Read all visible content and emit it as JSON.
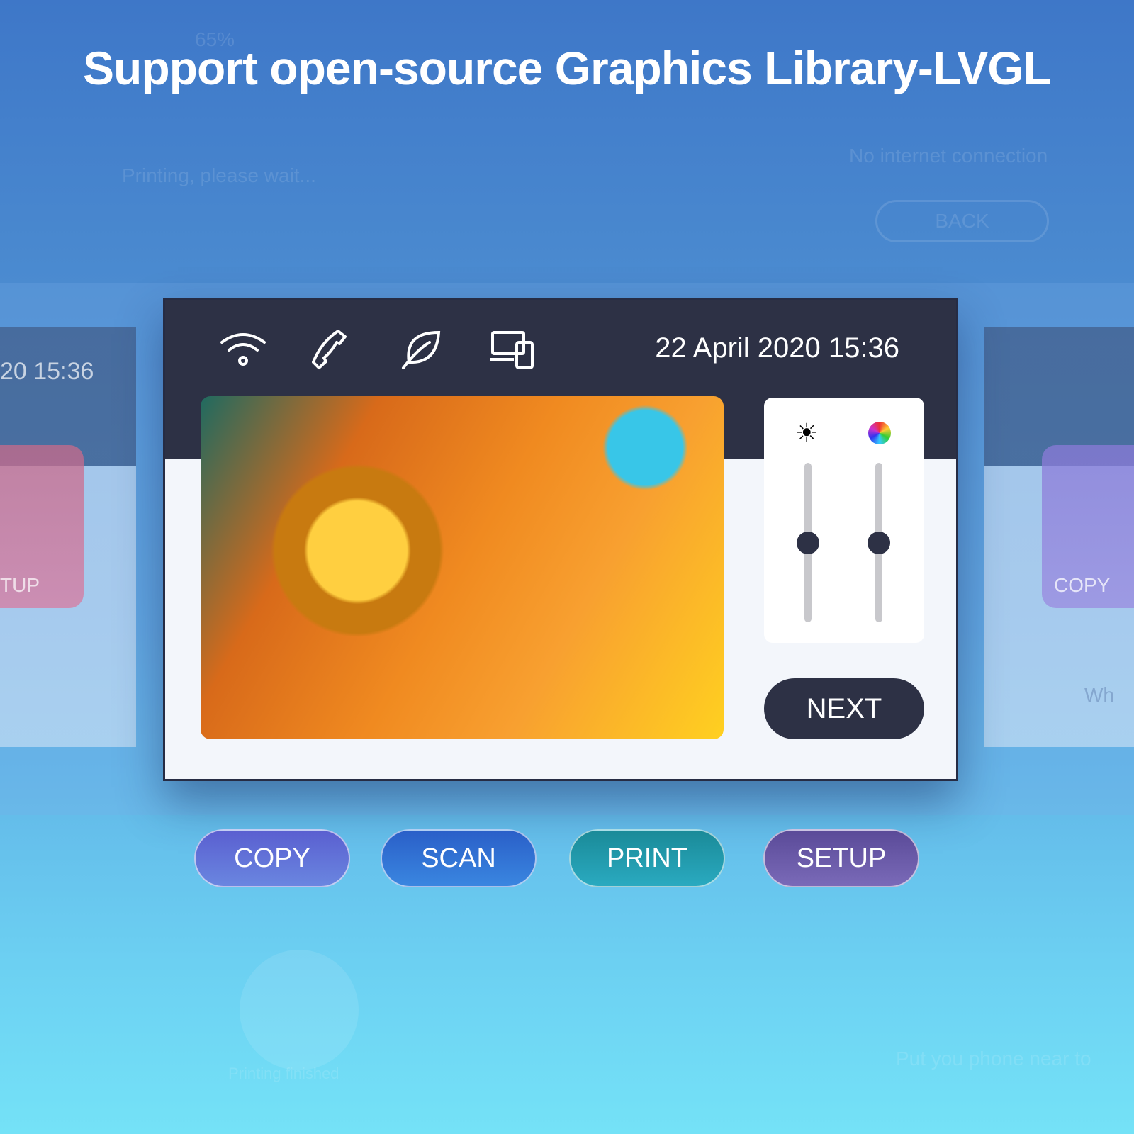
{
  "title": "Support open-source Graphics Library-LVGL",
  "background": {
    "printing_wait": "Printing, please wait...",
    "percent": "65%",
    "no_internet": "No internet connection",
    "back": "BACK",
    "printing_finished": "Printing finished",
    "phone_hint": "Put you phone near to",
    "left_time": "20 15:36",
    "left_label": "TUP",
    "right_label": "COPY",
    "right_text": "Wh"
  },
  "header": {
    "icons": [
      "wifi-icon",
      "phone-icon",
      "leaf-icon",
      "devices-icon"
    ],
    "datetime": "22 April 2020 15:36"
  },
  "sliders": [
    {
      "icon": "brightness-icon",
      "value_percent": 50
    },
    {
      "icon": "color-wheel-icon",
      "value_percent": 50
    }
  ],
  "next_label": "NEXT",
  "modes": [
    {
      "label": "COPY",
      "color": "#5a6fd8"
    },
    {
      "label": "SCAN",
      "color": "#2f74d0"
    },
    {
      "label": "PRINT",
      "color": "#1f9aa8"
    },
    {
      "label": "SETUP",
      "color": "#6a5aa8"
    }
  ],
  "colors": {
    "header": "#2d3145",
    "panel": "#f3f6fb"
  }
}
